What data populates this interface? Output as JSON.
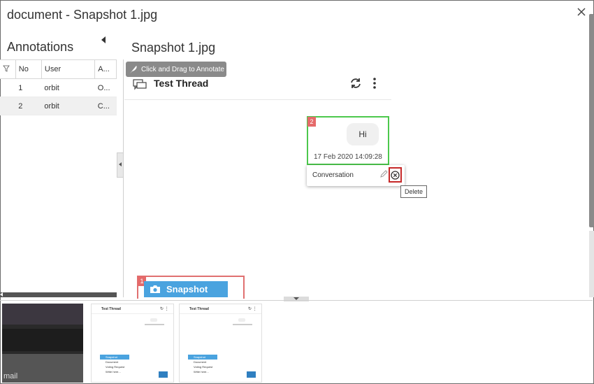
{
  "window": {
    "title": "document - Snapshot 1.jpg"
  },
  "annotations": {
    "title": "Annotations",
    "columns": [
      "No",
      "User",
      "A..."
    ],
    "rows": [
      {
        "no": "1",
        "user": "orbit",
        "a": "O..."
      },
      {
        "no": "2",
        "user": "orbit",
        "a": "C..."
      }
    ]
  },
  "viewer": {
    "title": "Snapshot 1.jpg",
    "drag_button": "Click and Drag to Annotate",
    "thread_title": "Test Thread",
    "annotation2": {
      "badge": "2",
      "message": "Hi",
      "timestamp": "17 Feb 2020 14:09:28"
    },
    "popup": {
      "label": "Conversation",
      "tooltip": "Delete"
    },
    "annotation1": {
      "badge": "1",
      "button_label": "Snapshot"
    }
  },
  "thumbnails": [
    {
      "caption": "mail"
    },
    {
      "title": "Test Thread",
      "menu": [
        "Snapshot",
        "Document",
        "Voting Request",
        "Write here..."
      ]
    },
    {
      "title": "Test Thread",
      "menu": [
        "Snapshot",
        "Document",
        "Voting Request",
        "Write here..."
      ]
    }
  ],
  "colors": {
    "green_box": "#4cc84c",
    "red_box": "#e07070",
    "snapshot_blue": "#4aa3df",
    "delete_highlight": "#c62828"
  }
}
